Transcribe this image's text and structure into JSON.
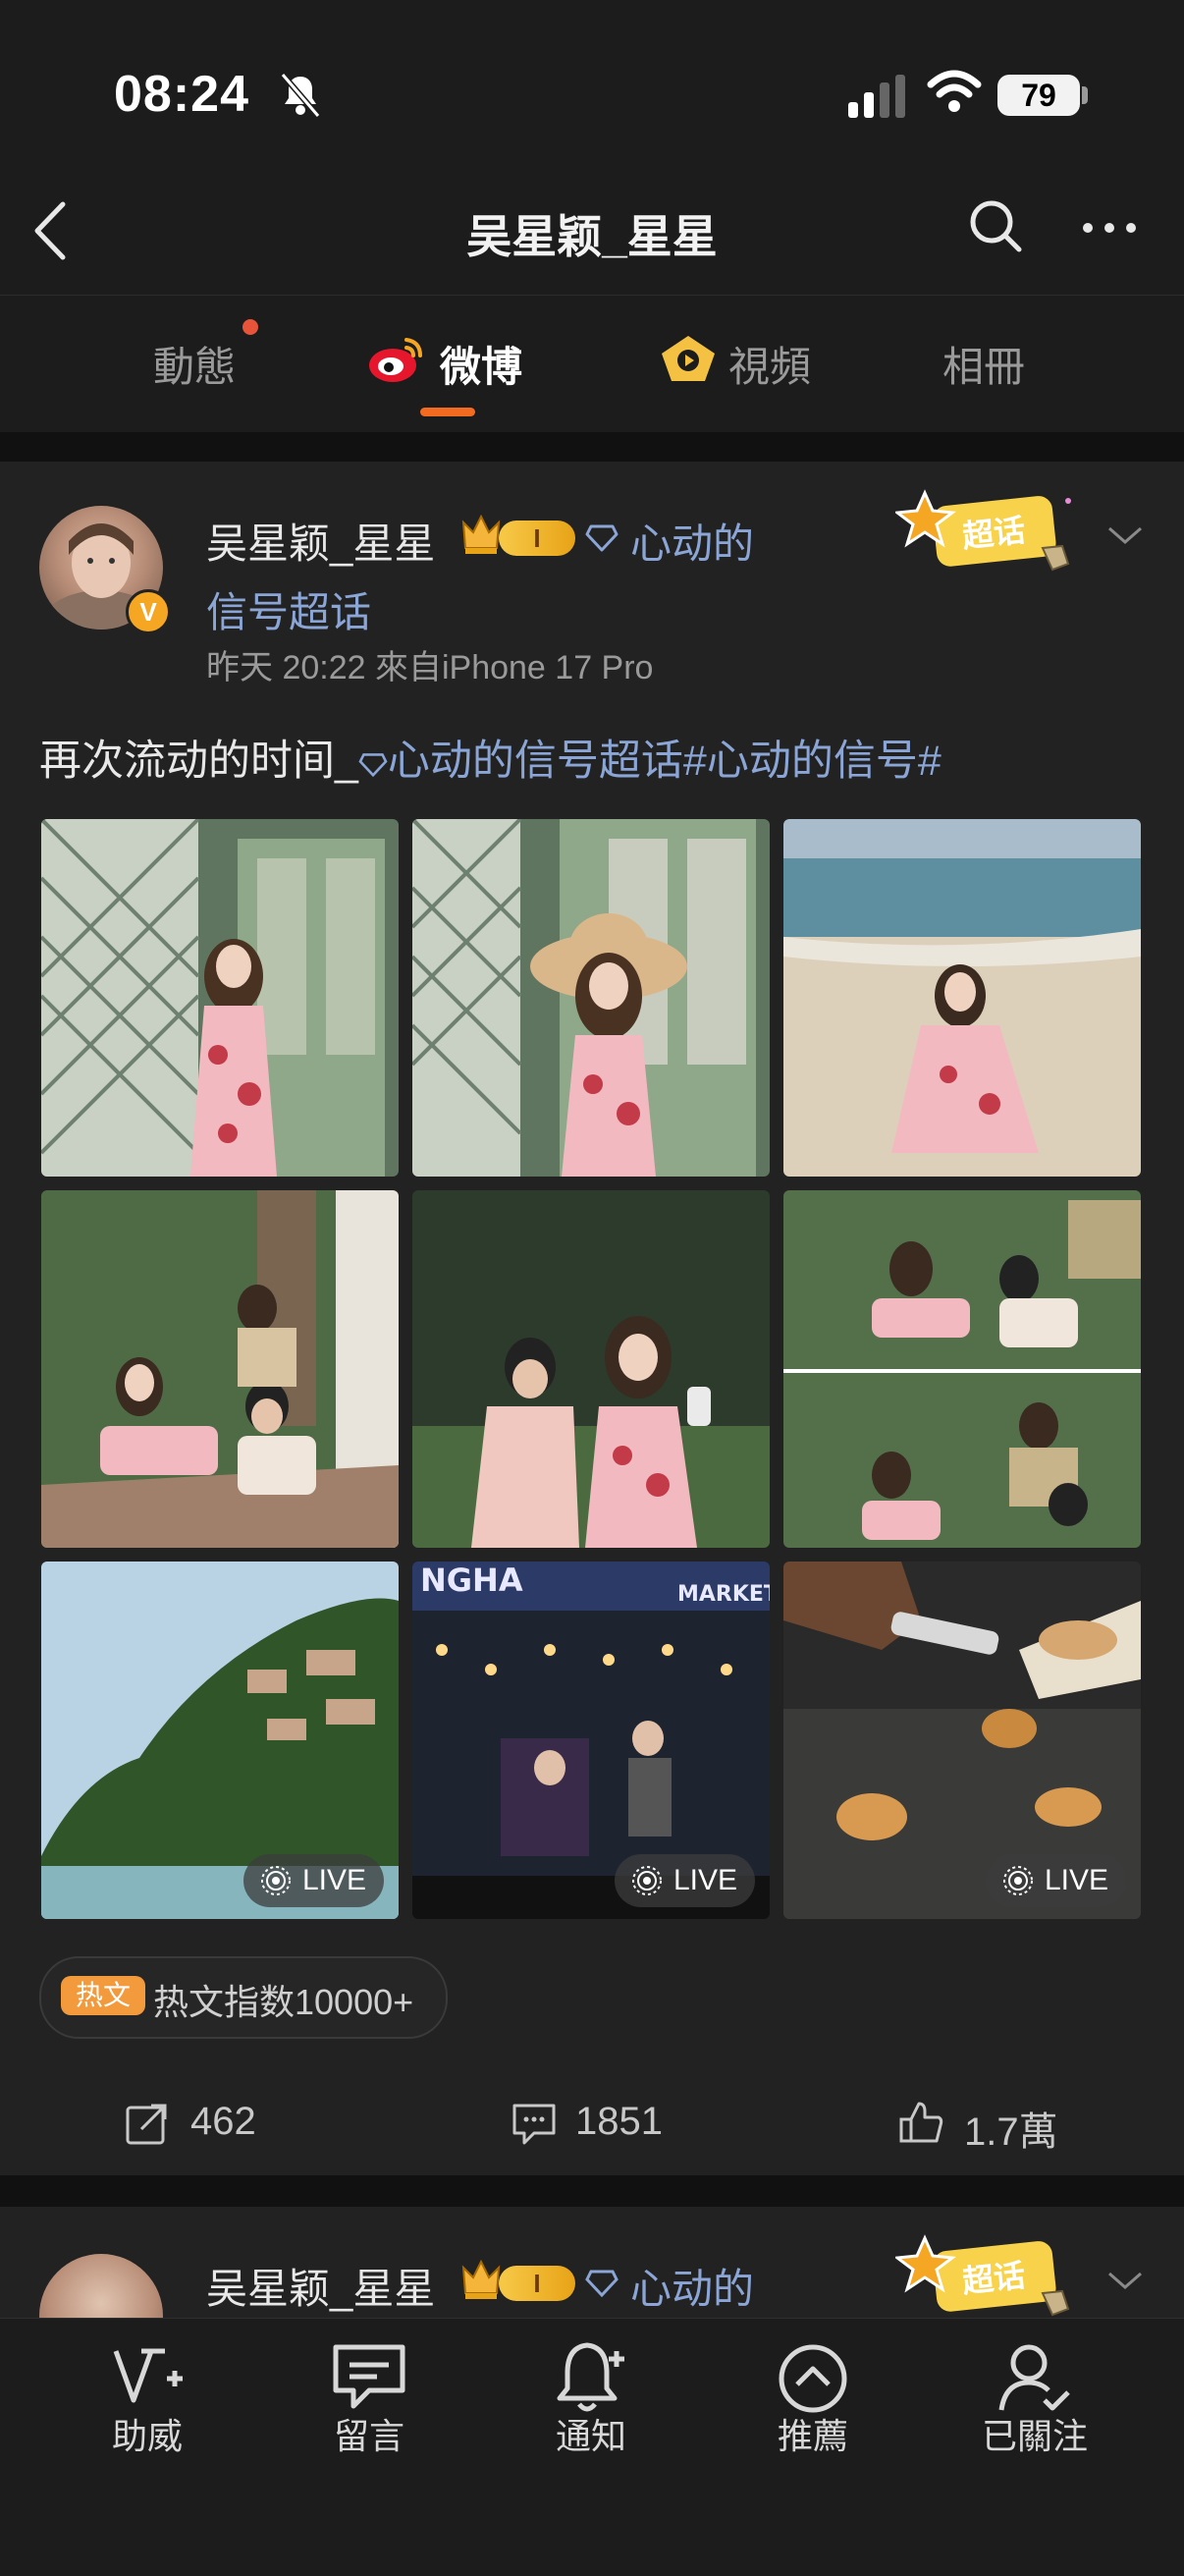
{
  "status_bar": {
    "time": "08:24",
    "battery": "79"
  },
  "nav": {
    "title": "吴星颖_星星"
  },
  "tabs": [
    {
      "label": "動態",
      "active": false
    },
    {
      "label": "微博",
      "active": true
    },
    {
      "label": "視頻",
      "active": false
    },
    {
      "label": "相冊",
      "active": false
    }
  ],
  "post": {
    "username": "吴星颖_星星",
    "rank_badge": "I",
    "topic_line1": "心动的",
    "topic_line2": "信号超话",
    "meta": "昨天 20:22  來自iPhone 17 Pro",
    "sticker": "超话",
    "text_plain": "再次流动的时间_",
    "text_topic": "心动的信号超话#心动的信号#",
    "images": [
      {
        "name": "photo-1",
        "live": false
      },
      {
        "name": "photo-2",
        "live": false
      },
      {
        "name": "photo-3",
        "live": false
      },
      {
        "name": "photo-4",
        "live": false
      },
      {
        "name": "photo-5",
        "live": false
      },
      {
        "name": "photo-6",
        "live": false
      },
      {
        "name": "photo-7",
        "live": true,
        "live_label": "LIVE"
      },
      {
        "name": "photo-8",
        "live": true,
        "live_label": "LIVE",
        "sign_text": "NGHA",
        "sign_text2": "MARKET"
      },
      {
        "name": "photo-9",
        "live": true,
        "live_label": "LIVE"
      }
    ],
    "hot_tag": "热文",
    "hot_text": "热文指数10000+",
    "actions": {
      "repost": "462",
      "comment": "1851",
      "like": "1.7萬"
    }
  },
  "post2": {
    "username": "吴星颖_星星",
    "rank_badge": "I",
    "topic_line1": "心动的",
    "sticker": "超话"
  },
  "bottom_nav": [
    {
      "label": "助威",
      "icon": "cheer-icon"
    },
    {
      "label": "留言",
      "icon": "message-icon"
    },
    {
      "label": "通知",
      "icon": "bell-icon"
    },
    {
      "label": "推薦",
      "icon": "up-arrow-icon"
    },
    {
      "label": "已關注",
      "icon": "followed-icon"
    }
  ],
  "colors": {
    "accent": "#f26b21",
    "topic": "#8aa5d6",
    "background": "#1a1a1a"
  }
}
